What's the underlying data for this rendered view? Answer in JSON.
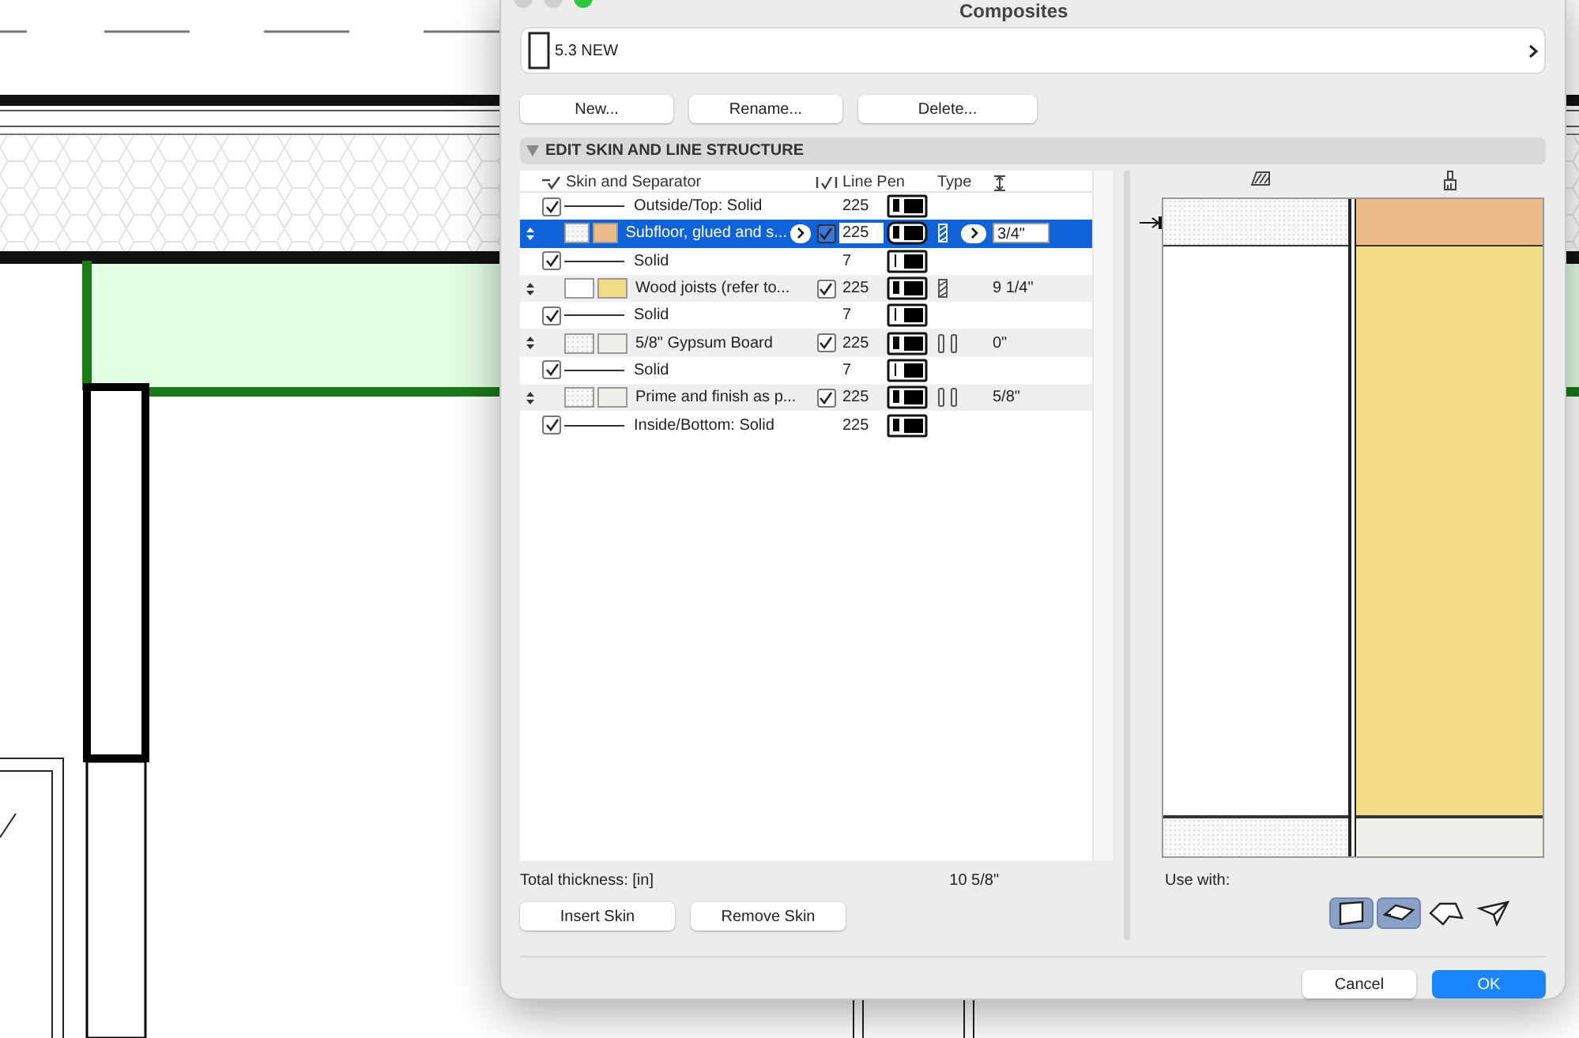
{
  "window": {
    "title": "Composites"
  },
  "composite": {
    "name": "5.3 NEW"
  },
  "buttons": [
    "New...",
    "Rename...",
    "Delete..."
  ],
  "section": {
    "title": "EDIT SKIN AND LINE STRUCTURE",
    "expanded": true
  },
  "table": {
    "columns": [
      "Skin and Separator",
      "Line Pen",
      "Type"
    ],
    "rows": [
      {
        "kind": "separator",
        "selected": false,
        "checked": true,
        "name": "Outside/Top: Solid",
        "pen": "225",
        "heavy_pen": true
      },
      {
        "kind": "skin",
        "selected": true,
        "name": "Subfloor, glued and s...",
        "lines_checked": true,
        "pen": "225",
        "heavy_pen": true,
        "core": true,
        "thickness": "3/4\"",
        "dotted": true,
        "color": "#edbb88"
      },
      {
        "kind": "separator",
        "selected": false,
        "checked": true,
        "name": "Solid",
        "pen": "7",
        "heavy_pen": false
      },
      {
        "kind": "skin",
        "selected": false,
        "name": "Wood joists (refer to...",
        "lines_checked": true,
        "pen": "225",
        "heavy_pen": true,
        "core": true,
        "thickness": "9 1/4\"",
        "dotted": false,
        "color": "#f3dc86"
      },
      {
        "kind": "separator",
        "selected": false,
        "checked": true,
        "name": "Solid",
        "pen": "7",
        "heavy_pen": false
      },
      {
        "kind": "skin",
        "selected": false,
        "name": "5/8\" Gypsum Board",
        "lines_checked": true,
        "pen": "225",
        "heavy_pen": true,
        "core": false,
        "thickness": "0\"",
        "dotted": true,
        "color": "#eff0ea"
      },
      {
        "kind": "separator",
        "selected": false,
        "checked": true,
        "name": "Solid",
        "pen": "7",
        "heavy_pen": false
      },
      {
        "kind": "skin",
        "selected": false,
        "name": "Prime and finish as p...",
        "lines_checked": true,
        "pen": "225",
        "heavy_pen": true,
        "core": false,
        "thickness": "5/8\"",
        "dotted": true,
        "color": "#eff0ea"
      },
      {
        "kind": "separator",
        "selected": false,
        "checked": true,
        "name": "Inside/Bottom: Solid",
        "pen": "225",
        "heavy_pen": true
      }
    ]
  },
  "total": {
    "label": "Total thickness: [in]",
    "value": "10 5/8\""
  },
  "skin_buttons": [
    "Insert Skin",
    "Remove Skin"
  ],
  "use_with": {
    "label": "Use with:",
    "options": [
      {
        "kind": "wall",
        "selected": true
      },
      {
        "kind": "slab",
        "selected": true
      },
      {
        "kind": "roof",
        "selected": false
      },
      {
        "kind": "shell",
        "selected": false
      }
    ]
  },
  "footer": [
    {
      "label": "Cancel",
      "default": false
    },
    {
      "label": "OK",
      "default": true
    }
  ]
}
